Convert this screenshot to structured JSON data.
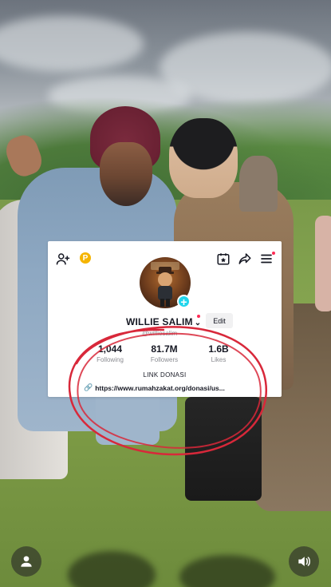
{
  "profile": {
    "username": "WILLIE SALIM",
    "handle": "@williesalim",
    "edit_label": "Edit",
    "coin_letter": "P",
    "stats": [
      {
        "value": "1,044",
        "label": "Following"
      },
      {
        "value": "81.7M",
        "label": "Followers"
      },
      {
        "value": "1.6B",
        "label": "Likes"
      }
    ],
    "bio_title": "LINK DONASI",
    "bio_link": "https://www.rumahzakat.org/donasi/us..."
  },
  "colors": {
    "accent_red": "#fe2c55",
    "add_badge": "#20d5ec",
    "annotation_red": "#d8283a"
  },
  "icons": [
    "add-user-icon",
    "coin-icon",
    "calendar-star-icon",
    "share-icon",
    "menu-icon",
    "link-icon",
    "person-icon",
    "volume-icon"
  ]
}
